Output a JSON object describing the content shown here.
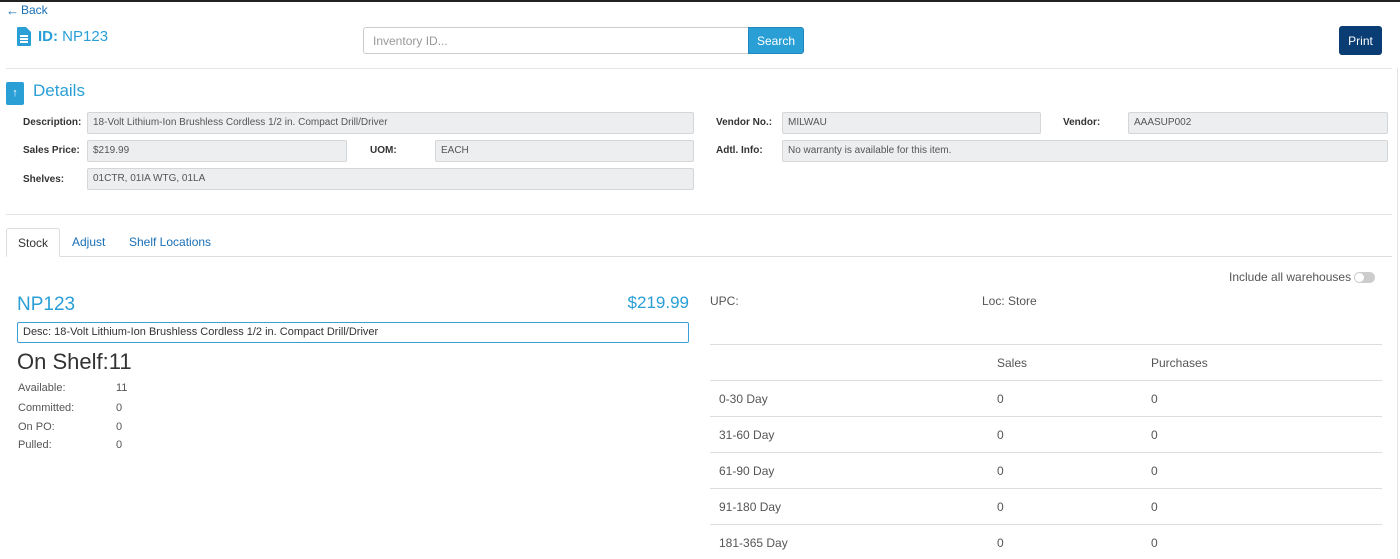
{
  "header": {
    "back_label": "Back",
    "id_prefix": "ID:",
    "id_value": "NP123",
    "search_placeholder": "Inventory ID...",
    "search_label": "Search",
    "print_label": "Print"
  },
  "details": {
    "title": "Details",
    "description_label": "Description:",
    "description_value": "18-Volt Lithium-Ion Brushless Cordless 1/2 in. Compact Drill/Driver",
    "sales_price_label": "Sales Price:",
    "sales_price_value": "$219.99",
    "uom_label": "UOM:",
    "uom_value": "EACH",
    "shelves_label": "Shelves:",
    "shelves_value": "01CTR, 01IA WTG, 01LA",
    "vendor_no_label": "Vendor No.:",
    "vendor_no_value": "MILWAU",
    "vendor_label": "Vendor:",
    "vendor_value": "AAASUP002",
    "adtl_info_label": "Adtl. Info:",
    "adtl_info_value": "No warranty is available for this item."
  },
  "tabs": [
    "Stock",
    "Adjust",
    "Shelf Locations"
  ],
  "stock": {
    "part_no": "NP123",
    "price": "$219.99",
    "desc": "Desc: 18-Volt Lithium-Ion Brushless Cordless 1/2 in. Compact Drill/Driver",
    "on_shelf_label": "On Shelf:",
    "on_shelf_value": "11",
    "rows": [
      {
        "label": "Available:",
        "value": "11"
      },
      {
        "label": "Committed:",
        "value": "0"
      },
      {
        "label": "On PO:",
        "value": "0"
      },
      {
        "label": "Pulled:",
        "value": "0"
      }
    ],
    "include_warehouses_label": "Include all warehouses",
    "include_warehouses_on": false,
    "upc_label": "UPC:",
    "loc_label": "Loc: Store",
    "history": {
      "headers": [
        "",
        "Sales",
        "Purchases"
      ],
      "rows": [
        [
          "0-30 Day",
          "0",
          "0"
        ],
        [
          "31-60 Day",
          "0",
          "0"
        ],
        [
          "61-90 Day",
          "0",
          "0"
        ],
        [
          "91-180 Day",
          "0",
          "0"
        ],
        [
          "181-365 Day",
          "0",
          "0"
        ]
      ]
    }
  },
  "colors": {
    "accent": "#2a9fd6",
    "print_button": "#0a3d73",
    "link": "#1a6fb5"
  }
}
